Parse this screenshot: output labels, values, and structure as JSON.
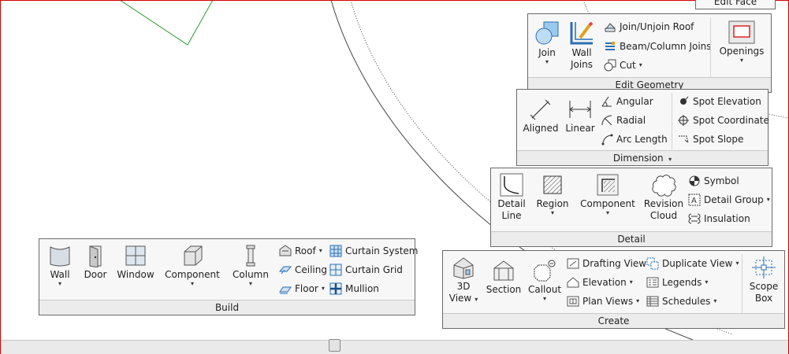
{
  "edit_face": {
    "label": "Edit Face"
  },
  "edit_geometry": {
    "title": "Edit Geometry",
    "join": "Join",
    "wall_joins_1": "Wall",
    "wall_joins_2": "Joins",
    "join_unjoin_roof": "Join/Unjoin Roof",
    "beam_column_joins": "Beam/Column Joins",
    "cut": "Cut",
    "openings": "Openings"
  },
  "dimension": {
    "title": "Dimension",
    "aligned": "Aligned",
    "linear": "Linear",
    "angular": "Angular",
    "radial": "Radial",
    "arc_length": "Arc Length",
    "spot_elevation": "Spot Elevation",
    "spot_coordinate": "Spot Coordinate",
    "spot_slope": "Spot Slope"
  },
  "detail": {
    "title": "Detail",
    "detail_line_1": "Detail",
    "detail_line_2": "Line",
    "region": "Region",
    "component": "Component",
    "revision_cloud_1": "Revision",
    "revision_cloud_2": "Cloud",
    "symbol": "Symbol",
    "detail_group": "Detail Group",
    "insulation": "Insulation"
  },
  "build": {
    "title": "Build",
    "wall": "Wall",
    "door": "Door",
    "window": "Window",
    "component": "Component",
    "column": "Column",
    "roof": "Roof",
    "ceiling": "Ceiling",
    "floor": "Floor",
    "curtain_system": "Curtain System",
    "curtain_grid": "Curtain Grid",
    "mullion": "Mullion"
  },
  "create": {
    "title": "Create",
    "view_3d_1": "3D",
    "view_3d_2": "View",
    "section": "Section",
    "callout": "Callout",
    "drafting_view": "Drafting View",
    "elevation": "Elevation",
    "plan_views": "Plan Views",
    "duplicate_view": "Duplicate View",
    "legends": "Legends",
    "schedules": "Schedules",
    "scope_box_1": "Scope",
    "scope_box_2": "Box"
  }
}
